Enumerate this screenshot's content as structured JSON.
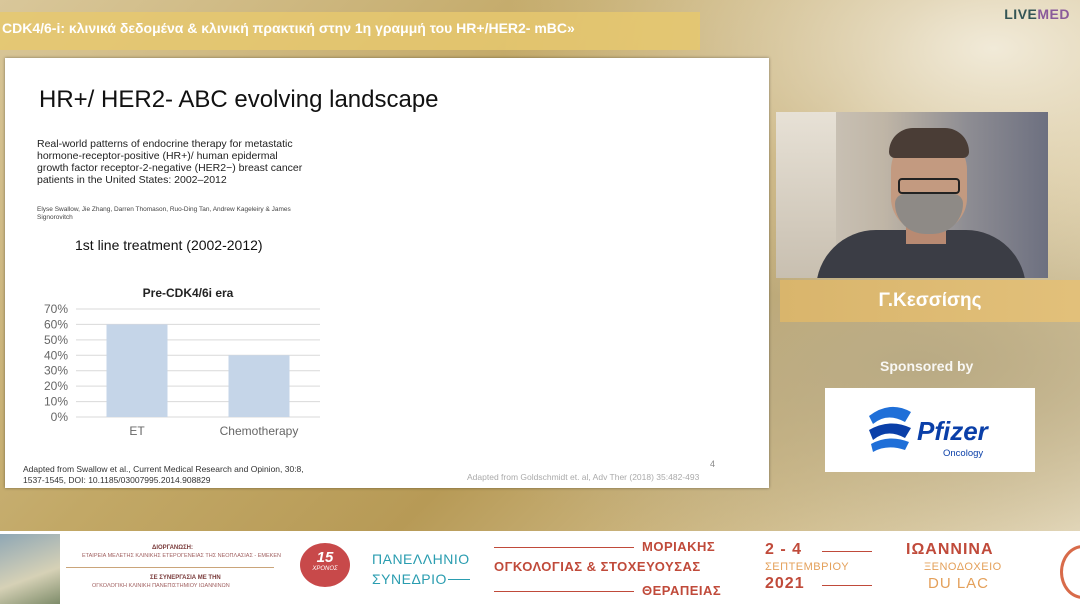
{
  "header": {
    "title": "CDK4/6-i: κλινικά δεδομένα & κλινική πρακτική στην 1η γραμμή του HR+/HER2- mBC»",
    "brand_a": "LIVE",
    "brand_b": "MED"
  },
  "slide": {
    "title": "HR+/ HER2- ABC evolving landscape",
    "paper_title": "Real-world patterns of endocrine therapy for metastatic hormone-receptor-positive (HR+)/ human epidermal growth factor receptor-2-negative (HER2−) breast cancer patients in the United States: 2002–2012",
    "authors": "Elyse Swallow, Jie Zhang, Darren Thomason, Ruo-Ding Tan, Andrew Kageleiry & James Signorovitch",
    "line_treatment": "1st line treatment  (2002-2012)",
    "footnote_left": "Adapted from Swallow et al., Current Medical Research and Opinion, 30:8, 1537-1545, DOI: 10.1185/03007995.2014.908829",
    "footnote_right": "Adapted from Goldschmidt et. al, Adv Ther (2018) 35:482-493",
    "page_number": "4"
  },
  "chart_data": {
    "type": "bar",
    "title": "Pre-CDK4/6i era",
    "categories": [
      "ET",
      "Chemotherapy"
    ],
    "values": [
      60,
      40
    ],
    "ylim": [
      0,
      70
    ],
    "yticks": [
      "0%",
      "10%",
      "20%",
      "30%",
      "40%",
      "50%",
      "60%",
      "70%"
    ],
    "grid": true,
    "bar_color": "#c5d5e8"
  },
  "speaker": {
    "name": "Γ.Κεσσίσης"
  },
  "sponsor": {
    "label": "Sponsored by",
    "logo_word": "Pfizer",
    "logo_sub": "Oncology"
  },
  "footer": {
    "org_label": "ΔΙΟΡΓΑΝΩΣΗ:",
    "org_name": "ΕΤΑΙΡΕΙΑ ΜΕΛΕΤΗΣ ΚΛΙΝΙΚΗΣ ΕΤΕΡΟΓΕΝΕΙΑΣ ΤΗΣ ΝΕΟΠΛΑΣΙΑΣ - ΕΜΕΚΕΝ",
    "coop_label": "ΣΕ ΣΥΝΕΡΓΑΣΙΑ ΜΕ ΤΗΝ",
    "coop_name": "ΟΓΚΟΛΟΓΙΚΗ ΚΛΙΝΙΚΗ ΠΑΝΕΠΙΣΤΗΜΙΟΥ ΙΩΑΝΝΙΝΩΝ",
    "seal_number": "15",
    "seal_text": "ΧΡΟΝΟΣ",
    "conf_line1": "ΠΑΝΕΛΛΗΝΙΟ",
    "conf_line2": "ΣΥΝΕΔΡΙΟ",
    "topic_line1": "ΜΟΡΙΑΚΗΣ",
    "topic_line2": "ΟΓΚΟΛΟΓΙΑΣ & ΣΤΟΧΕΥΟΥΣΑΣ",
    "topic_line3": "ΘΕΡΑΠΕΙΑΣ",
    "date_days": "2 - 4",
    "date_month": "ΣΕΠΤΕΜΒΡΙΟΥ",
    "date_year": "2021",
    "venue_city": "ΙΩΑΝΝΙΝΑ",
    "venue_hotel1": "ΞΕΝΟΔΟΧΕΙΟ",
    "venue_hotel2": "DU LAC"
  }
}
